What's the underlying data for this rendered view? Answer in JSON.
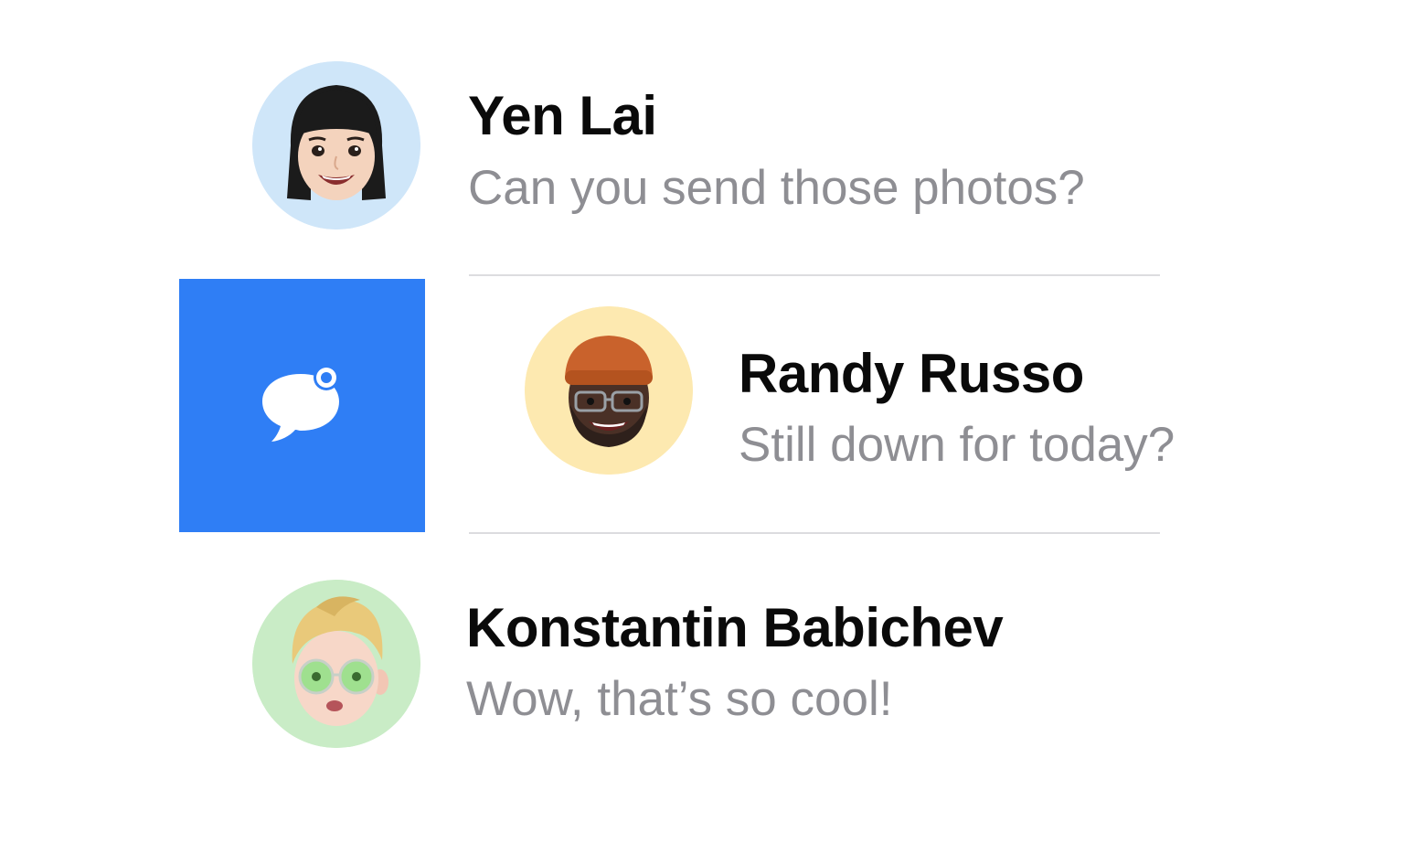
{
  "conversations": [
    {
      "name": "Yen Lai",
      "preview": "Can you send those photos?",
      "avatar_bg": "#cfe6f9",
      "avatar_icon": "memoji-woman-bangs"
    },
    {
      "name": "Randy Russo",
      "preview": "Still down for today?",
      "avatar_bg": "#fde9b0",
      "avatar_icon": "memoji-man-beanie-glasses"
    },
    {
      "name": "Konstantin Babichev",
      "preview": "Wow, that’s so cool!",
      "avatar_bg": "#c9ecc6",
      "avatar_icon": "memoji-man-blond-green-glasses"
    }
  ],
  "swipe_action": {
    "icon": "message-unread-icon",
    "color": "#2f7ef5"
  },
  "colors": {
    "name_text": "#0a0a0a",
    "preview_text": "#8e8e93",
    "divider": "#dcdcdf"
  }
}
